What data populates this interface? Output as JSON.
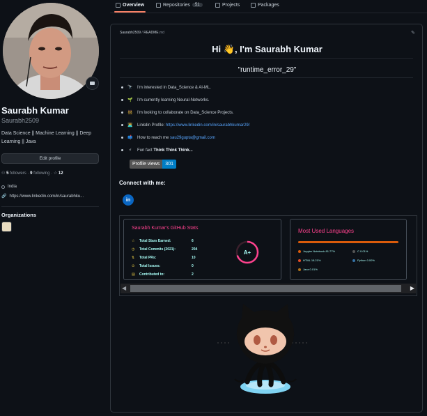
{
  "tabs": [
    {
      "label": "Overview",
      "active": true
    },
    {
      "label": "Repositories",
      "count": "51"
    },
    {
      "label": "Projects"
    },
    {
      "label": "Packages"
    }
  ],
  "profile": {
    "name": "Saurabh Kumar",
    "login": "Saurabh2509",
    "bio": "Data Science || Machine Learning || Deep Learning || Java",
    "edit_button": "Edit profile",
    "followers_count": "5",
    "followers_label": "followers",
    "following_count": "9",
    "following_label": "following",
    "stars_count": "12",
    "location": "India",
    "website": "https://www.linkedin.com/in/saurabhku..."
  },
  "organizations": {
    "title": "Organizations"
  },
  "readme": {
    "path_user": "Saurabh2509",
    "path_sep": " / ",
    "path_file": "README",
    "path_ext": ".md",
    "greeting": "Hi 👋, I'm Saurabh Kumar",
    "handle": "\"runtime_error_29\"",
    "items": [
      {
        "emoji": "🔭",
        "text": "I'm interested in Data_Science & AI-ML."
      },
      {
        "emoji": "🌱",
        "text": "I'm currently learning Neural-Networks."
      },
      {
        "emoji": "👯",
        "text": "I'm looking to collaborate on Data_Science Projects."
      },
      {
        "emoji": "👨‍💻",
        "text": "Linkdin Profile: ",
        "link": "https://www.linkedin.com/in/saurabhkumar29/"
      },
      {
        "emoji": "📫",
        "text": "How to reach me ",
        "link": "sau29gupta@gmail.com"
      },
      {
        "emoji": "⚡",
        "text": "Fun fact ",
        "bold": "Think Think Think..."
      }
    ],
    "badge_label": "Profile views",
    "badge_value": "301",
    "connect_title": "Connect with me:",
    "linkedin_glyph": "in"
  },
  "stats": {
    "title": "Saurabh Kumar's GitHub Stats",
    "rows": [
      {
        "label": "Total Stars Earned:",
        "value": "6"
      },
      {
        "label": "Total Commits (2021):",
        "value": "204"
      },
      {
        "label": "Total PRs:",
        "value": "10"
      },
      {
        "label": "Total Issues:",
        "value": "0"
      },
      {
        "label": "Contributed to:",
        "value": "2"
      }
    ],
    "grade": "A+",
    "grade_progress": 0.7,
    "colors": {
      "title": "#fe428e",
      "icon": "#f8d847",
      "text": "#a9fef7",
      "ring": "#fe428e"
    }
  },
  "languages": {
    "title": "Most Used Languages",
    "items": [
      {
        "name": "Jupyter Notebook 81.77%",
        "color": "#da5b0b"
      },
      {
        "name": "C 0.01%",
        "color": "#555555"
      },
      {
        "name": "HTML 18.21%",
        "color": "#e34c26"
      },
      {
        "name": "Python 0.00%",
        "color": "#3572a5"
      },
      {
        "name": "Java 0.01%",
        "color": "#b07219"
      }
    ]
  }
}
